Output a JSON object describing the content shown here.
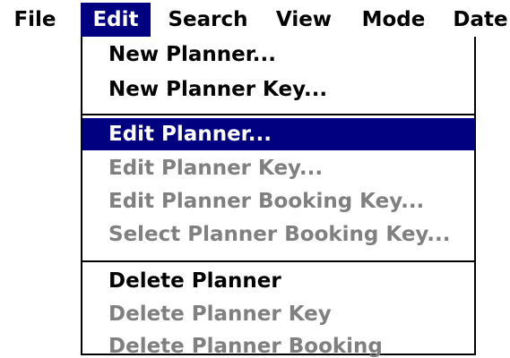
{
  "menubar": {
    "items": [
      {
        "label": "File",
        "active": false
      },
      {
        "label": "Edit",
        "active": true
      },
      {
        "label": "Search",
        "active": false
      },
      {
        "label": "View",
        "active": false
      },
      {
        "label": "Mode",
        "active": false
      },
      {
        "label": "Date",
        "active": false
      }
    ]
  },
  "edit_menu": {
    "items": [
      {
        "label": "New Planner...",
        "enabled": true,
        "selected": false
      },
      {
        "label": "New Planner Key...",
        "enabled": true,
        "selected": false
      },
      {
        "label": "Edit Planner...",
        "enabled": true,
        "selected": true
      },
      {
        "label": "Edit Planner Key...",
        "enabled": false,
        "selected": false
      },
      {
        "label": "Edit Planner Booking Key...",
        "enabled": false,
        "selected": false
      },
      {
        "label": "Select Planner Booking Key...",
        "enabled": false,
        "selected": false
      },
      {
        "label": "Delete Planner",
        "enabled": true,
        "selected": false
      },
      {
        "label": "Delete Planner Key",
        "enabled": false,
        "selected": false
      },
      {
        "label": "Delete Planner Booking",
        "enabled": false,
        "selected": false
      }
    ]
  },
  "colors": {
    "highlight": "#000080",
    "disabled_text": "#808080",
    "text": "#000000",
    "background": "#ffffff"
  }
}
